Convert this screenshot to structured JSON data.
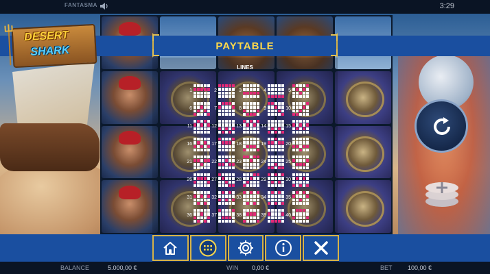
{
  "topbar": {
    "brand": "FANTASMA",
    "sound_icon": "speaker-icon",
    "clock": "3:29"
  },
  "logo": {
    "line1": "DESERT",
    "line2": "SHARK"
  },
  "paytable": {
    "title": "PAYTABLE",
    "lines_title": "LINES"
  },
  "paylines": [
    {
      "num": "1",
      "rows": [
        1,
        1,
        1,
        1,
        1
      ]
    },
    {
      "num": "2",
      "rows": [
        0,
        0,
        0,
        0,
        0
      ]
    },
    {
      "num": "3",
      "rows": [
        2,
        2,
        2,
        2,
        2
      ]
    },
    {
      "num": "4",
      "rows": [
        3,
        3,
        3,
        3,
        3
      ]
    },
    {
      "num": "5",
      "rows": [
        0,
        1,
        2,
        1,
        0
      ]
    },
    {
      "num": "6",
      "rows": [
        3,
        2,
        1,
        2,
        3
      ]
    },
    {
      "num": "7",
      "rows": [
        1,
        0,
        0,
        0,
        1
      ]
    },
    {
      "num": "8",
      "rows": [
        2,
        3,
        3,
        3,
        2
      ]
    },
    {
      "num": "9",
      "rows": [
        0,
        0,
        1,
        2,
        3
      ]
    },
    {
      "num": "10",
      "rows": [
        3,
        3,
        2,
        1,
        0
      ]
    },
    {
      "num": "11",
      "rows": [
        1,
        0,
        1,
        0,
        1
      ]
    },
    {
      "num": "12",
      "rows": [
        2,
        3,
        2,
        3,
        2
      ]
    },
    {
      "num": "13",
      "rows": [
        0,
        1,
        0,
        1,
        0
      ]
    },
    {
      "num": "14",
      "rows": [
        3,
        2,
        3,
        2,
        3
      ]
    },
    {
      "num": "15",
      "rows": [
        1,
        2,
        1,
        2,
        1
      ]
    },
    {
      "num": "16",
      "rows": [
        2,
        1,
        2,
        1,
        2
      ]
    },
    {
      "num": "17",
      "rows": [
        0,
        1,
        1,
        1,
        0
      ]
    },
    {
      "num": "18",
      "rows": [
        3,
        2,
        2,
        2,
        3
      ]
    },
    {
      "num": "19",
      "rows": [
        1,
        1,
        0,
        1,
        1
      ]
    },
    {
      "num": "20",
      "rows": [
        2,
        2,
        3,
        2,
        2
      ]
    },
    {
      "num": "21",
      "rows": [
        1,
        1,
        2,
        1,
        1
      ]
    },
    {
      "num": "22",
      "rows": [
        2,
        2,
        1,
        2,
        2
      ]
    },
    {
      "num": "23",
      "rows": [
        0,
        0,
        1,
        0,
        0
      ]
    },
    {
      "num": "24",
      "rows": [
        3,
        3,
        2,
        3,
        3
      ]
    },
    {
      "num": "25",
      "rows": [
        1,
        2,
        2,
        2,
        1
      ]
    },
    {
      "num": "26",
      "rows": [
        2,
        1,
        1,
        1,
        2
      ]
    },
    {
      "num": "27",
      "rows": [
        0,
        1,
        2,
        3,
        3
      ]
    },
    {
      "num": "28",
      "rows": [
        3,
        2,
        1,
        0,
        0
      ]
    },
    {
      "num": "29",
      "rows": [
        0,
        2,
        0,
        2,
        0
      ]
    },
    {
      "num": "30",
      "rows": [
        3,
        1,
        3,
        1,
        3
      ]
    },
    {
      "num": "31",
      "rows": [
        1,
        3,
        1,
        3,
        1
      ]
    },
    {
      "num": "32",
      "rows": [
        2,
        0,
        2,
        0,
        2
      ]
    },
    {
      "num": "33",
      "rows": [
        0,
        3,
        0,
        3,
        0
      ]
    },
    {
      "num": "34",
      "rows": [
        3,
        0,
        3,
        0,
        3
      ]
    },
    {
      "num": "35",
      "rows": [
        1,
        0,
        2,
        0,
        1
      ]
    },
    {
      "num": "36",
      "rows": [
        2,
        3,
        1,
        3,
        2
      ]
    },
    {
      "num": "37",
      "rows": [
        0,
        2,
        2,
        2,
        0
      ]
    },
    {
      "num": "38",
      "rows": [
        3,
        1,
        1,
        1,
        3
      ]
    },
    {
      "num": "39",
      "rows": [
        1,
        3,
        3,
        3,
        1
      ]
    },
    {
      "num": "40",
      "rows": [
        2,
        0,
        0,
        0,
        2
      ]
    }
  ],
  "menu": [
    {
      "name": "home-button",
      "icon": "home-icon"
    },
    {
      "name": "paytable-button",
      "icon": "grid-dots-icon"
    },
    {
      "name": "settings-button",
      "icon": "gear-icon"
    },
    {
      "name": "info-button",
      "icon": "info-icon"
    },
    {
      "name": "close-button",
      "icon": "close-icon"
    }
  ],
  "footer": {
    "balance_label": "BALANCE",
    "balance_value": "5.000,00 €",
    "win_label": "WIN",
    "win_value": "0,00 €",
    "bet_label": "BET",
    "bet_value": "100,00 €"
  },
  "colors": {
    "accent_gold": "#ffd94a",
    "banner_blue": "#1a4fa0",
    "line_pink": "#e32977"
  }
}
